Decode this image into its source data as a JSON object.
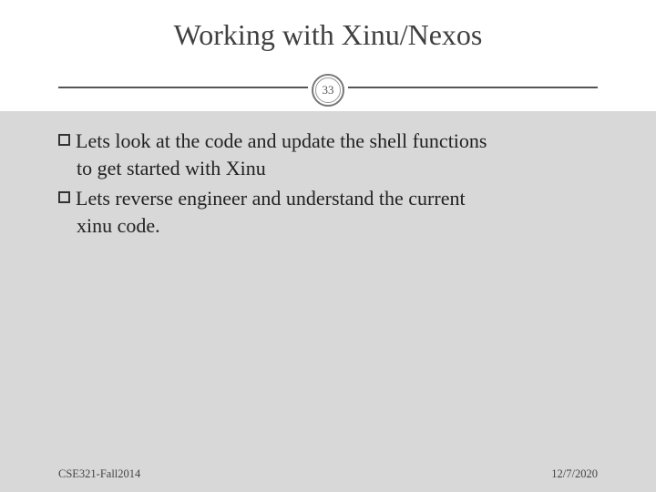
{
  "title": "Working with Xinu/Nexos",
  "slide_number": "33",
  "bullets": [
    {
      "first": "Lets look at the code and update the shell functions",
      "cont": "to get started with Xinu"
    },
    {
      "first": "Lets reverse engineer and understand the current",
      "cont": "xinu code."
    }
  ],
  "footer": {
    "left": "CSE321-Fall2014",
    "right": "12/7/2020"
  }
}
